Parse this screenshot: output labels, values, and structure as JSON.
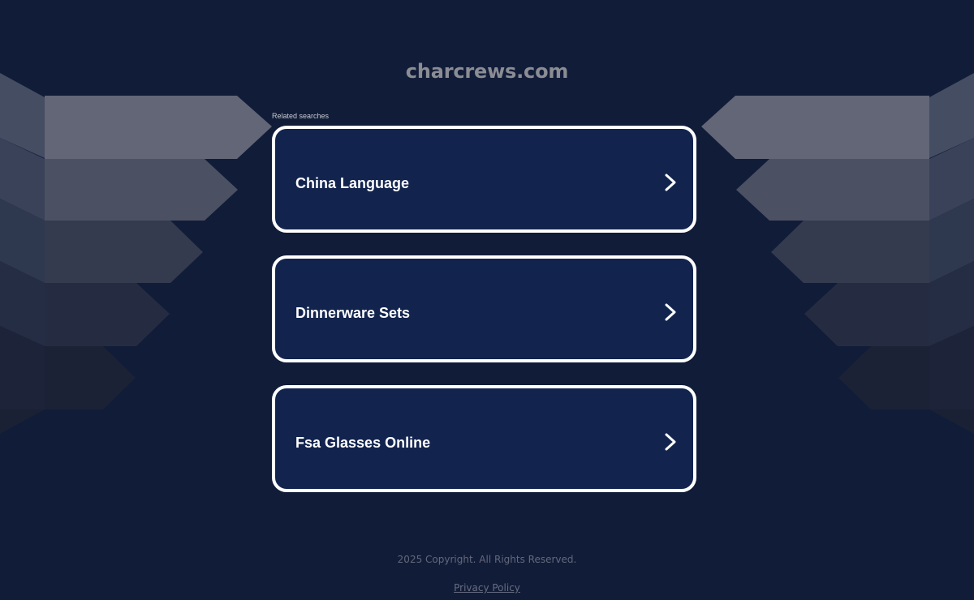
{
  "site": {
    "domain": "charcrews.com"
  },
  "related": {
    "label": "Related searches",
    "items": [
      {
        "label": "China Language"
      },
      {
        "label": "Dinnerware Sets"
      },
      {
        "label": "Fsa Glasses Online"
      }
    ]
  },
  "footer": {
    "copyright": "2025 Copyright. All Rights Reserved.",
    "privacy_label": "Privacy Policy"
  },
  "icons": {
    "chevron": "chevron-right-icon"
  },
  "colors": {
    "background": "#101c37",
    "card_fill": "#12244e",
    "card_border": "#ffffff",
    "title_text": "#8b8d94",
    "footer_text": "#63687a"
  }
}
